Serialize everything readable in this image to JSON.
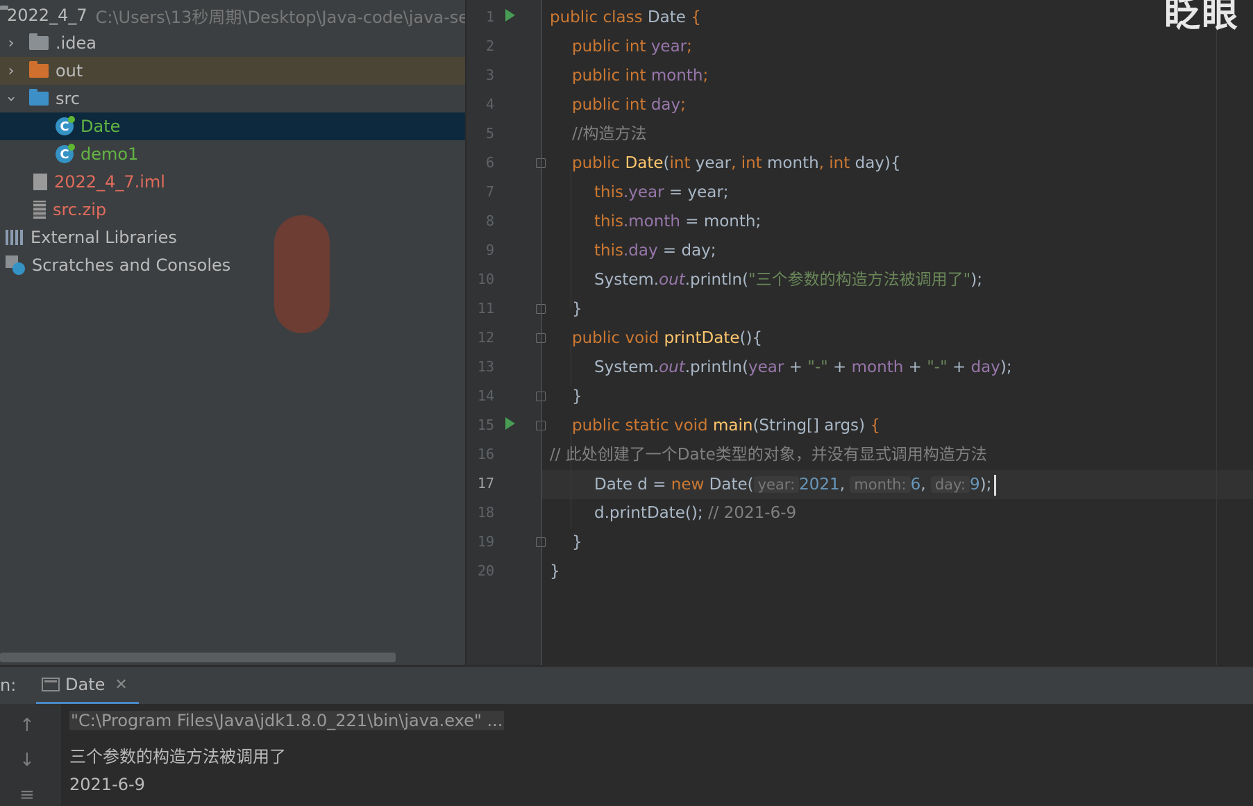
{
  "project": {
    "root_name": "2022_4_7",
    "root_path": "C:\\Users\\13秒周期\\Desktop\\Java-code\\java-se",
    "items": [
      {
        "label": ".idea"
      },
      {
        "label": "out"
      },
      {
        "label": "src"
      },
      {
        "label": "Date"
      },
      {
        "label": "demo1"
      },
      {
        "label": "2022_4_7.iml"
      },
      {
        "label": "src.zip"
      },
      {
        "label": "External Libraries"
      },
      {
        "label": "Scratches and Consoles"
      }
    ]
  },
  "editor": {
    "line_numbers": [
      "1",
      "2",
      "3",
      "4",
      "5",
      "6",
      "7",
      "8",
      "9",
      "10",
      "11",
      "12",
      "13",
      "14",
      "15",
      "16",
      "17",
      "18",
      "19",
      "20"
    ],
    "current_line": "17",
    "overlay_text": "眨眼",
    "code": {
      "l1_kw": "public class ",
      "l1_name": "Date ",
      "l1_brace": "{",
      "l2_kw": "public int ",
      "l2_fld": "year",
      "l2_end": ";",
      "l3_kw": "public int ",
      "l3_fld": "month",
      "l3_end": ";",
      "l4_kw": "public int ",
      "l4_fld": "day",
      "l4_end": ";",
      "l5_cmt": "//构造方法",
      "l6_kw": "public ",
      "l6_fn": "Date",
      "l6_p1": "(",
      "l6_k1": "int ",
      "l6_a1": "year",
      "l6_c1": ", ",
      "l6_k2": "int ",
      "l6_a2": "month",
      "l6_c2": ", ",
      "l6_k3": "int ",
      "l6_a3": "day",
      "l6_end": "){",
      "l7_kw": "this",
      "l7_fld": ".year",
      "l7_rest": " = year;",
      "l8_kw": "this",
      "l8_fld": ".month",
      "l8_rest": " = month;",
      "l9_kw": "this",
      "l9_fld": ".day",
      "l9_rest": " = day;",
      "l10_a": "System.",
      "l10_out": "out",
      "l10_b": ".println(",
      "l10_str": "\"三个参数的构造方法被调用了\"",
      "l10_end": ");",
      "l11": "}",
      "l12_kw": "public void ",
      "l12_fn": "printDate",
      "l12_end": "(){",
      "l13_a": "System.",
      "l13_out": "out",
      "l13_b": ".println(",
      "l13_f1": "year",
      "l13_p1": " + ",
      "l13_s1": "\"-\"",
      "l13_p2": " + ",
      "l13_f2": "month",
      "l13_p3": " + ",
      "l13_s2": "\"-\"",
      "l13_p4": " + ",
      "l13_f3": "day",
      "l13_end": ");",
      "l14": "}",
      "l15_kw": "public static void ",
      "l15_fn": "main",
      "l15_rest": "(String[] args) ",
      "l15_brace": "{",
      "l16_cmt": "// 此处创建了一个Date类型的对象，并没有显式调用构造方法",
      "l17_a": "Date d = ",
      "l17_kw": "new ",
      "l17_b": "Date(",
      "l17_h1": "year:",
      "l17_n1": "2021",
      "l17_c1": ", ",
      "l17_h2": "month:",
      "l17_n2": "6",
      "l17_c2": ", ",
      "l17_h3": "day:",
      "l17_n3": "9",
      "l17_end": ");",
      "l18_a": "d.printDate(); ",
      "l18_cmt": "// 2021-6-9",
      "l19": "}",
      "l20": "}"
    }
  },
  "run": {
    "label": "n:",
    "tab": "Date",
    "close": "✕",
    "output": [
      "\"C:\\Program Files\\Java\\jdk1.8.0_221\\bin\\java.exe\" ...",
      "三个参数的构造方法被调用了",
      "2021-6-9"
    ]
  },
  "colors": {
    "keyword": "#cc7832",
    "field": "#9876aa",
    "string": "#6a8759",
    "comment": "#808080",
    "number": "#6897bb",
    "method": "#ffc66d"
  }
}
